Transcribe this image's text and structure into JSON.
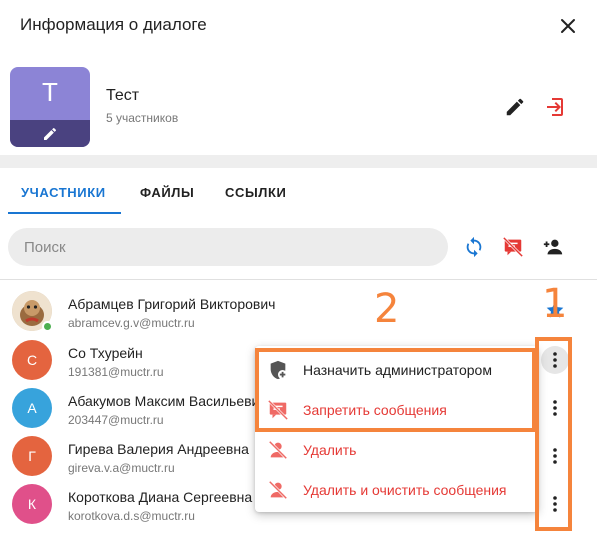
{
  "dialog": {
    "title": "Информация о диалоге"
  },
  "group": {
    "avatar_letter": "Т",
    "name": "Тест",
    "members_count": "5 участников"
  },
  "tabs": [
    {
      "label": "УЧАСТНИКИ",
      "active": true
    },
    {
      "label": "ФАЙЛЫ",
      "active": false
    },
    {
      "label": "ССЫЛКИ",
      "active": false
    }
  ],
  "search": {
    "placeholder": "Поиск",
    "value": ""
  },
  "members": [
    {
      "name": "Абрамцев Григорий Викторович",
      "email": "abramcev.g.v@muctr.ru",
      "avatar_letter": "",
      "avatar_color": "#c9b8a2",
      "online": true
    },
    {
      "name": "Со Тхурейн",
      "email": "191381@muctr.ru",
      "avatar_letter": "С",
      "avatar_color": "#e4643f",
      "online": false
    },
    {
      "name": "Абакумов Максим Васильевич",
      "email": "203447@muctr.ru",
      "avatar_letter": "А",
      "avatar_color": "#37a3dc",
      "online": false
    },
    {
      "name": "Гирева Валерия Андреевна",
      "email": "gireva.v.a@muctr.ru",
      "avatar_letter": "Г",
      "avatar_color": "#e4643f",
      "online": false
    },
    {
      "name": "Короткова Диана Сергеевна",
      "email": "korotkova.d.s@muctr.ru",
      "avatar_letter": "К",
      "avatar_color": "#e0508a",
      "online": false
    }
  ],
  "context_menu": [
    {
      "label": "Назначить администратором",
      "icon": "shield-add-icon",
      "danger": false
    },
    {
      "label": "Запретить сообщения",
      "icon": "block-messages-icon",
      "danger": true
    },
    {
      "label": "Удалить",
      "icon": "remove-user-icon",
      "danger": true
    },
    {
      "label": "Удалить и очистить сообщения",
      "icon": "remove-user-icon",
      "danger": true
    }
  ],
  "annotations": {
    "label_1": "1",
    "label_2": "2"
  },
  "colors": {
    "accent": "#1976d2",
    "danger": "#e53935",
    "annotation": "#f5843c",
    "group_avatar": "#8c84d6"
  }
}
